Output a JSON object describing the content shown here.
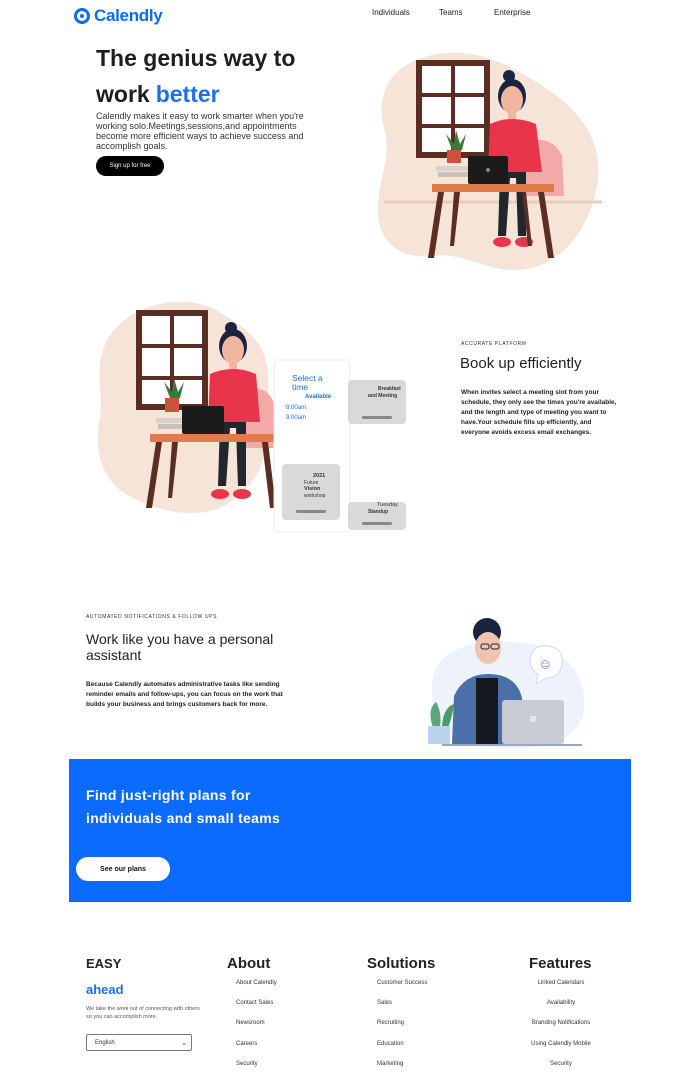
{
  "header": {
    "logo_text": "Calendly",
    "nav": [
      "Individuals",
      "Teams",
      "Enterprise"
    ]
  },
  "hero": {
    "title_line1": "The genius way to",
    "title_line2_prefix": "work",
    "title_line2_accent": "better",
    "description": "Calendly makes it easy to work smarter when you're working solo.Meetings,sessions,and appointments become more efficient ways to achieve success and accomplish goals.",
    "cta_label": "Sign up for free"
  },
  "scheduler_section": {
    "eyebrow": "ACCURATE PLATFORM",
    "title": "Book up efficiently",
    "description": "When invites select a meeting slot from your schedule, they only see the times you're available, and the length and type of meeting you want to have.Your schedule fills up efficiently, and everyone avoids excess email exchanges.",
    "calendar": {
      "select_label": "Select a time",
      "available_label": "Available",
      "times": [
        "8:00am",
        "9:00am"
      ],
      "card_1_title": "Breakfast",
      "card_1_sub": "and Meeting",
      "card_2_title": "2021",
      "card_2_sub_1": "Future",
      "card_2_sub_2": "Vision",
      "card_2_sub_3": "workshop",
      "card_3_title": "Tuesday",
      "card_3_sub": "Standup"
    }
  },
  "assistant_section": {
    "eyebrow": "AUTOMATED NOTIFICATIONS & FOLLOW UPS",
    "title": "Work like you have a personal assistant",
    "description": "Because Calendly automates administrative tasks like sending reminder emails and follow-ups, you can focus on the work that builds your business and brings customers back for more."
  },
  "plans_banner": {
    "title": "Find just-right plans for individuals and small teams",
    "cta_label": "See our plans"
  },
  "footer": {
    "brand": "EASY",
    "brand_accent": "ahead",
    "tagline": "We take the work out of connecting with others so you can accomplish more.",
    "language": "English",
    "columns": [
      {
        "heading": "About",
        "links": [
          "About Calendly",
          "Contact Sales",
          "Newsroom",
          "Careers",
          "Security"
        ]
      },
      {
        "heading": "Solutions",
        "links": [
          "Customer Success",
          "Sales",
          "Recruiting",
          "Education",
          "Marketing"
        ]
      },
      {
        "heading": "Features",
        "links": [
          "Linked Calendars",
          "Availability",
          "Branding Notifications",
          "Using Calendly Mobile",
          "Security"
        ]
      }
    ]
  },
  "colors": {
    "brand_blue": "#0b6bff",
    "accent_text_blue": "#1f6fe6",
    "blob_peach": "#f6e4d9",
    "shirt_red": "#e8354c",
    "desk_orange": "#e07b4a"
  }
}
